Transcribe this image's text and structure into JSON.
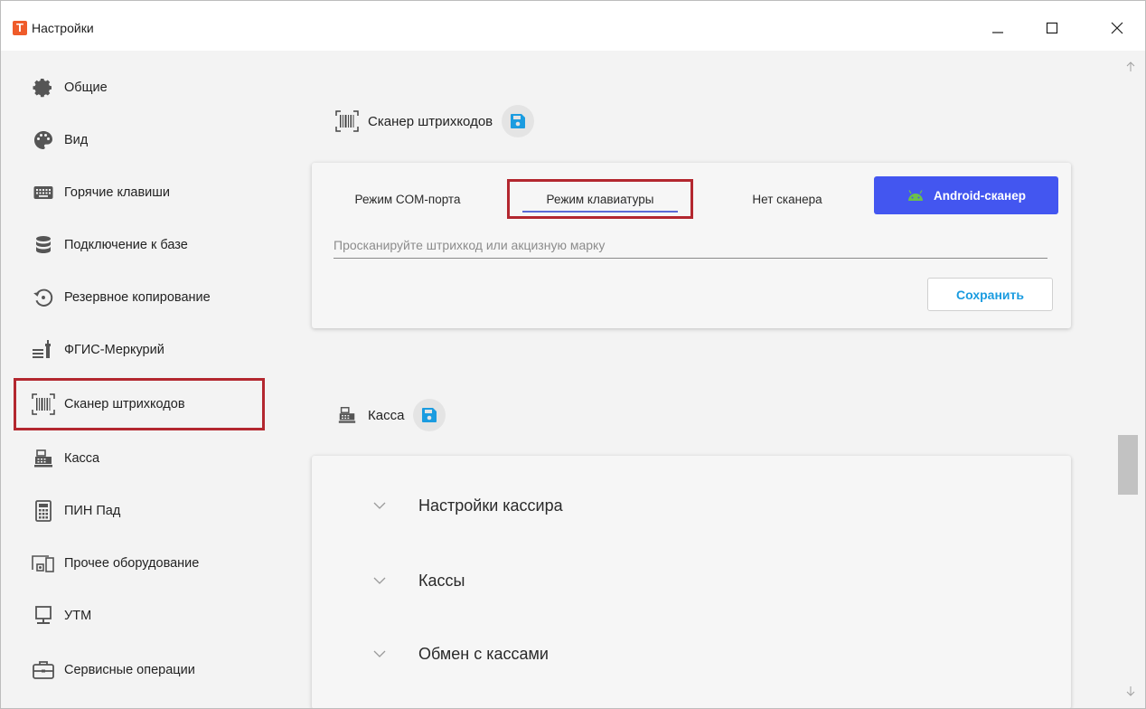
{
  "window": {
    "title": "Настройки",
    "app_icon_letter": "T",
    "accent_color": "#ef5b2a"
  },
  "sidebar": {
    "items": [
      {
        "label": "Общие",
        "icon": "gear-icon"
      },
      {
        "label": "Вид",
        "icon": "palette-icon"
      },
      {
        "label": "Горячие клавиши",
        "icon": "keyboard-icon"
      },
      {
        "label": "Подключение к базе",
        "icon": "database-icon"
      },
      {
        "label": "Резервное копирование",
        "icon": "backup-icon"
      },
      {
        "label": "ФГИС-Меркурий",
        "icon": "mercury-icon"
      },
      {
        "label": "Сканер штрихкодов",
        "icon": "barcode-icon",
        "active": true
      },
      {
        "label": "Касса",
        "icon": "cash-register-icon"
      },
      {
        "label": "ПИН Пад",
        "icon": "calculator-icon"
      },
      {
        "label": "Прочее оборудование",
        "icon": "devices-icon"
      },
      {
        "label": "УТМ",
        "icon": "monitor-icon"
      },
      {
        "label": "Сервисные операции",
        "icon": "briefcase-icon"
      }
    ],
    "highlight_color": "#b3272f"
  },
  "scanner_section": {
    "title": "Сканер штрихкодов",
    "tabs": [
      {
        "label": "Режим COM-порта"
      },
      {
        "label": "Режим клавиатуры",
        "selected": true
      },
      {
        "label": "Нет сканера"
      },
      {
        "label": "Android-сканер",
        "primary": true
      }
    ],
    "input_placeholder": "Просканируйте штрихкод или акцизную марку",
    "input_value": "",
    "save_label": "Сохранить",
    "primary_color": "#4356f0",
    "save_color": "#1b9ce0"
  },
  "cash_section": {
    "title": "Касса",
    "accordion": [
      {
        "label": "Настройки кассира"
      },
      {
        "label": "Кассы"
      },
      {
        "label": "Обмен с кассами"
      }
    ]
  }
}
